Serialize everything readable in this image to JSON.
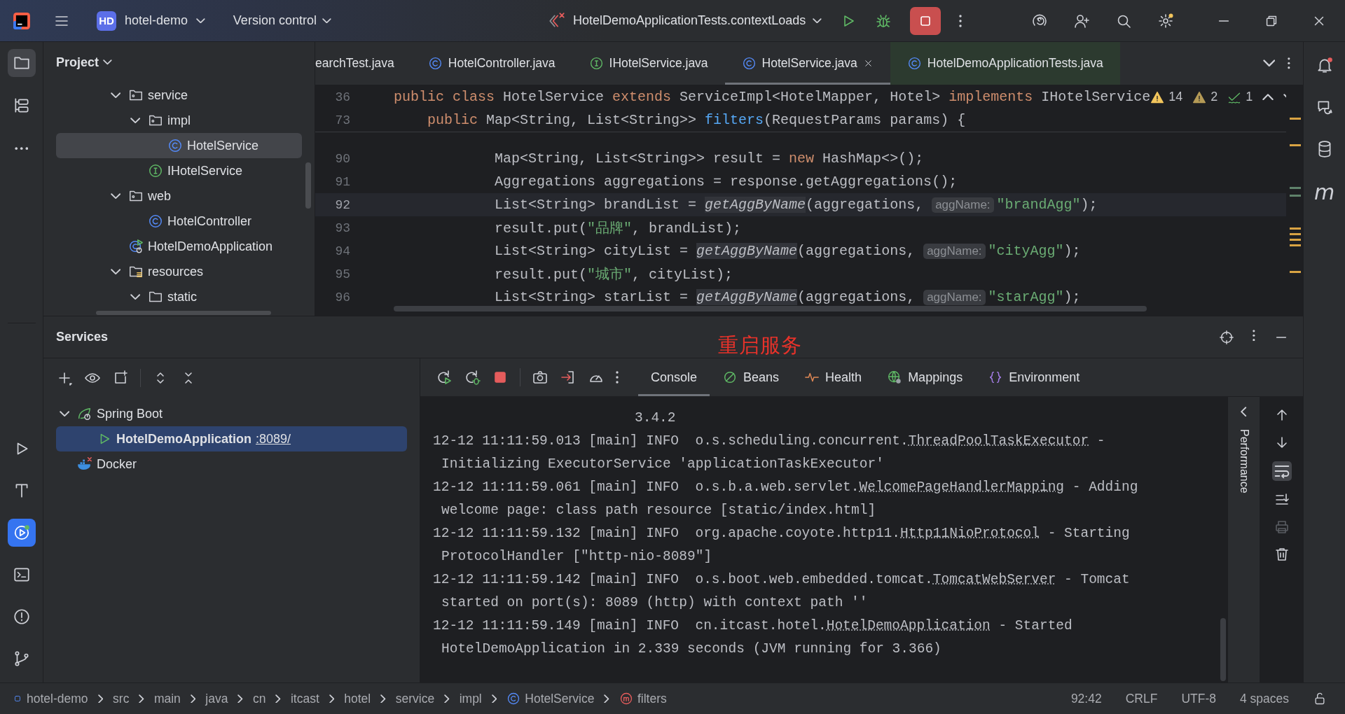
{
  "title_bar": {
    "project_badge": "HD",
    "project": "hotel-demo",
    "vcs_menu": "Version control",
    "run_configuration": "HotelDemoApplicationTests.contextLoads",
    "running": true
  },
  "left_toolbar": {
    "top": [
      {
        "kind": "project",
        "selected": true
      },
      {
        "kind": "structure",
        "selected": false
      },
      {
        "kind": "more",
        "selected": false
      }
    ],
    "bottom": [
      {
        "kind": "run",
        "selected": false
      },
      {
        "kind": "build",
        "selected": false
      },
      {
        "kind": "services",
        "selected": true
      },
      {
        "kind": "terminal",
        "selected": false
      },
      {
        "kind": "problems",
        "selected": false
      },
      {
        "kind": "git",
        "selected": false
      }
    ]
  },
  "project_panel": {
    "title": "Project",
    "tree": [
      {
        "label": "service",
        "kind": "package",
        "expanded": true,
        "selected": false,
        "children": [
          {
            "label": "impl",
            "kind": "package",
            "expanded": true,
            "selected": false,
            "children": [
              {
                "label": "HotelService",
                "kind": "class",
                "selected": true
              }
            ]
          },
          {
            "label": "IHotelService",
            "kind": "interface",
            "selected": false
          }
        ]
      },
      {
        "label": "web",
        "kind": "package",
        "expanded": true,
        "selected": false,
        "children": [
          {
            "label": "HotelController",
            "kind": "class",
            "selected": false
          }
        ]
      },
      {
        "label": "HotelDemoApplication",
        "kind": "app",
        "selected": false
      },
      {
        "label": "resources",
        "kind": "resources",
        "expanded": true,
        "selected": false,
        "children": [
          {
            "label": "static",
            "kind": "folder",
            "expanded": true,
            "selected": false
          }
        ]
      }
    ]
  },
  "editor": {
    "tabs": [
      {
        "label": "earchTest.java",
        "kind": "cut",
        "selected": false
      },
      {
        "label": "HotelController.java",
        "kind": "class",
        "selected": false
      },
      {
        "label": "IHotelService.java",
        "kind": "interface",
        "selected": false
      },
      {
        "label": "HotelService.java",
        "kind": "class",
        "selected": true
      },
      {
        "label": "HotelDemoApplicationTests.java",
        "kind": "test-class",
        "selected": false
      }
    ],
    "inspections": {
      "warnings": "14",
      "weak_warnings": "2",
      "typos": "1"
    },
    "sticky_lines": [
      {
        "number": "36",
        "tokens": [
          {
            "kind": "keyword",
            "text": "public class "
          },
          {
            "kind": "plain",
            "text": "HotelService "
          },
          {
            "kind": "keyword",
            "text": "extends "
          },
          {
            "kind": "plain",
            "text": "ServiceImpl<HotelMapper, Hotel> "
          },
          {
            "kind": "keyword",
            "text": "implements "
          },
          {
            "kind": "plain",
            "text": "IHotelService"
          }
        ]
      },
      {
        "number": "73",
        "tokens": [
          {
            "kind": "keyword",
            "text": "    public "
          },
          {
            "kind": "plain",
            "text": "Map<String, List<String>> "
          },
          {
            "kind": "method",
            "text": "filters"
          },
          {
            "kind": "plain",
            "text": "(RequestParams params) {"
          }
        ]
      }
    ],
    "lines": [
      {
        "number": "90",
        "current": false,
        "tokens": [
          {
            "kind": "plain",
            "text": "            Map<String, List<String>> result = "
          },
          {
            "kind": "keyword",
            "text": "new "
          },
          {
            "kind": "plain",
            "text": "HashMap<>();"
          }
        ]
      },
      {
        "number": "91",
        "current": false,
        "tokens": [
          {
            "kind": "plain",
            "text": "            Aggregations aggregations = response.getAggregations();"
          }
        ]
      },
      {
        "number": "92",
        "current": true,
        "tokens": [
          {
            "kind": "plain",
            "text": "            List<String> brandList = "
          },
          {
            "kind": "call",
            "text": "getAggByName"
          },
          {
            "kind": "plain",
            "text": "(aggregations, "
          },
          {
            "kind": "hint",
            "text": "aggName:"
          },
          {
            "kind": "string",
            "text": "\"brandAgg\""
          },
          {
            "kind": "plain",
            "text": ");"
          }
        ]
      },
      {
        "number": "93",
        "current": false,
        "tokens": [
          {
            "kind": "plain",
            "text": "            result.put("
          },
          {
            "kind": "string",
            "text": "\"品牌\""
          },
          {
            "kind": "plain",
            "text": ", brandList);"
          }
        ]
      },
      {
        "number": "94",
        "current": false,
        "tokens": [
          {
            "kind": "plain",
            "text": "            List<String> cityList = "
          },
          {
            "kind": "call",
            "text": "getAggByName"
          },
          {
            "kind": "plain",
            "text": "(aggregations, "
          },
          {
            "kind": "hint",
            "text": "aggName:"
          },
          {
            "kind": "string",
            "text": "\"cityAgg\""
          },
          {
            "kind": "plain",
            "text": ");"
          }
        ]
      },
      {
        "number": "95",
        "current": false,
        "tokens": [
          {
            "kind": "plain",
            "text": "            result.put("
          },
          {
            "kind": "string",
            "text": "\"城市\""
          },
          {
            "kind": "plain",
            "text": ", cityList);"
          }
        ]
      },
      {
        "number": "96",
        "current": false,
        "tokens": [
          {
            "kind": "plain",
            "text": "            List<String> starList = "
          },
          {
            "kind": "call",
            "text": "getAggByName"
          },
          {
            "kind": "plain",
            "text": "(aggregations, "
          },
          {
            "kind": "hint",
            "text": "aggName:"
          },
          {
            "kind": "string",
            "text": "\"starAgg\""
          },
          {
            "kind": "plain",
            "text": ");"
          }
        ]
      }
    ]
  },
  "right_toolbar": [
    {
      "kind": "notifications"
    },
    {
      "kind": "ai-chat"
    },
    {
      "kind": "database"
    },
    {
      "kind": "maven",
      "glyph": "m"
    }
  ],
  "annotation": "重启服务",
  "services": {
    "title": "Services",
    "tree": [
      {
        "label": "Spring Boot",
        "kind": "spring-boot",
        "expanded": true,
        "selected": false,
        "children": [
          {
            "label": "HotelDemoApplication",
            "port_link": ":8089/",
            "kind": "running-app",
            "selected": true
          }
        ]
      },
      {
        "label": "Docker",
        "kind": "docker",
        "selected": false
      }
    ],
    "console_tabs": [
      {
        "label": "Console",
        "kind": "console",
        "selected": true
      },
      {
        "label": "Beans",
        "kind": "beans",
        "selected": false
      },
      {
        "label": "Health",
        "kind": "health",
        "selected": false
      },
      {
        "label": "Mappings",
        "kind": "mappings",
        "selected": false
      },
      {
        "label": "Environment",
        "kind": "environment",
        "selected": false
      }
    ],
    "console_lines": [
      {
        "kind": "banner",
        "text": "3.4.2"
      },
      {
        "kind": "log",
        "head": "12-12 11:11:59.013 [main] INFO  o.s.scheduling.concurrent.",
        "link": "ThreadPoolTaskExecutor",
        "tail": " -",
        "wrapped": "Initializing ExecutorService 'applicationTaskExecutor'"
      },
      {
        "kind": "log",
        "head": "12-12 11:11:59.061 [main] INFO  o.s.b.a.web.servlet.",
        "link": "WelcomePageHandlerMapping",
        "tail": " - Adding",
        "wrapped": "welcome page: class path resource [static/index.html]"
      },
      {
        "kind": "log",
        "head": "12-12 11:11:59.132 [main] INFO  org.apache.coyote.http11.",
        "link": "Http11NioProtocol",
        "tail": " - Starting",
        "wrapped": "ProtocolHandler [\"http-nio-8089\"]"
      },
      {
        "kind": "log",
        "head": "12-12 11:11:59.142 [main] INFO  o.s.boot.web.embedded.tomcat.",
        "link": "TomcatWebServer",
        "tail": " - Tomcat",
        "wrapped": "started on port(s): 8089 (http) with context path ''"
      },
      {
        "kind": "log",
        "head": "12-12 11:11:59.149 [main] INFO  cn.itcast.hotel.",
        "link": "HotelDemoApplication",
        "tail": " - Started",
        "wrapped": "HotelDemoApplication in 2.339 seconds (JVM running for 3.366)"
      }
    ],
    "side_tab": "Performance"
  },
  "status_bar": {
    "breadcrumbs": [
      {
        "text": "hotel-demo",
        "kind": "module"
      },
      {
        "text": "src",
        "kind": "dir"
      },
      {
        "text": "main",
        "kind": "dir"
      },
      {
        "text": "java",
        "kind": "dir"
      },
      {
        "text": "cn",
        "kind": "dir"
      },
      {
        "text": "itcast",
        "kind": "dir"
      },
      {
        "text": "hotel",
        "kind": "dir"
      },
      {
        "text": "service",
        "kind": "dir"
      },
      {
        "text": "impl",
        "kind": "dir"
      },
      {
        "text": "HotelService",
        "kind": "class"
      },
      {
        "text": "filters",
        "kind": "method"
      }
    ],
    "position": "92:42",
    "line_separator": "CRLF",
    "encoding": "UTF-8",
    "indent": "4 spaces"
  }
}
